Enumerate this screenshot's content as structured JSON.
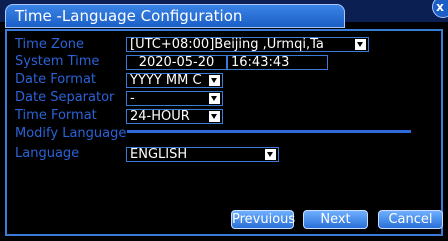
{
  "window": {
    "title": "Time -Language Configuration",
    "close_glyph": "x"
  },
  "fields": {
    "time_zone": {
      "label": "Time Zone",
      "value": "[UTC+08:00]Beijing ,Urmqi,Ta"
    },
    "system_time": {
      "label": "System Time",
      "date": "2020-05-20",
      "time": "16:43:43"
    },
    "date_format": {
      "label": "Date Format",
      "value": "YYYY MM C"
    },
    "date_separator": {
      "label": "Date Separator",
      "value": "-"
    },
    "time_format": {
      "label": "Time Format",
      "value": "24-HOUR"
    },
    "modify_language": {
      "label": "Modify Language"
    },
    "language": {
      "label": "Language",
      "value": "ENGLISH"
    }
  },
  "buttons": {
    "previous": "Prevuious",
    "next": "Next",
    "cancel": "Cancel"
  },
  "colors": {
    "label": "#2b63d8",
    "accent": "#3a7bd5",
    "button": "#4a8ef0"
  }
}
